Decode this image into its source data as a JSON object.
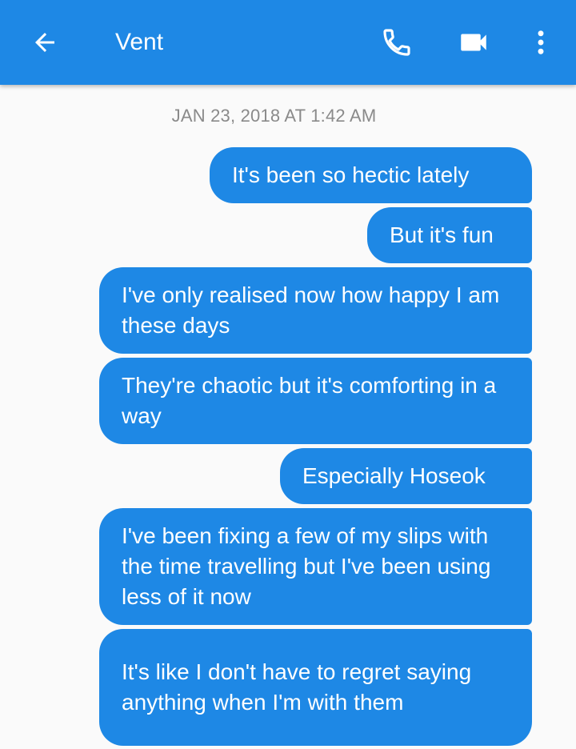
{
  "header": {
    "back_icon": "arrow-back-icon",
    "title": "Vent",
    "call_icon": "phone-icon",
    "video_icon": "video-camera-icon",
    "menu_icon": "more-vert-icon",
    "bar_color": "#1e88e5"
  },
  "conversation": {
    "timestamp": "JAN 23, 2018 AT 1:42 AM",
    "bubble_color": "#1e88e5",
    "messages": [
      {
        "text": "It's been so hectic lately"
      },
      {
        "text": "But it's fun"
      },
      {
        "text": "I've only realised now how happy I am these days"
      },
      {
        "text": "They're chaotic but it's comforting in a way"
      },
      {
        "text": "Especially Hoseok"
      },
      {
        "text": "I've been fixing a few of my slips with the time travelling but I've been using less of it now"
      },
      {
        "text": "It's like I don't have to regret saying anything when I'm with them"
      }
    ]
  }
}
